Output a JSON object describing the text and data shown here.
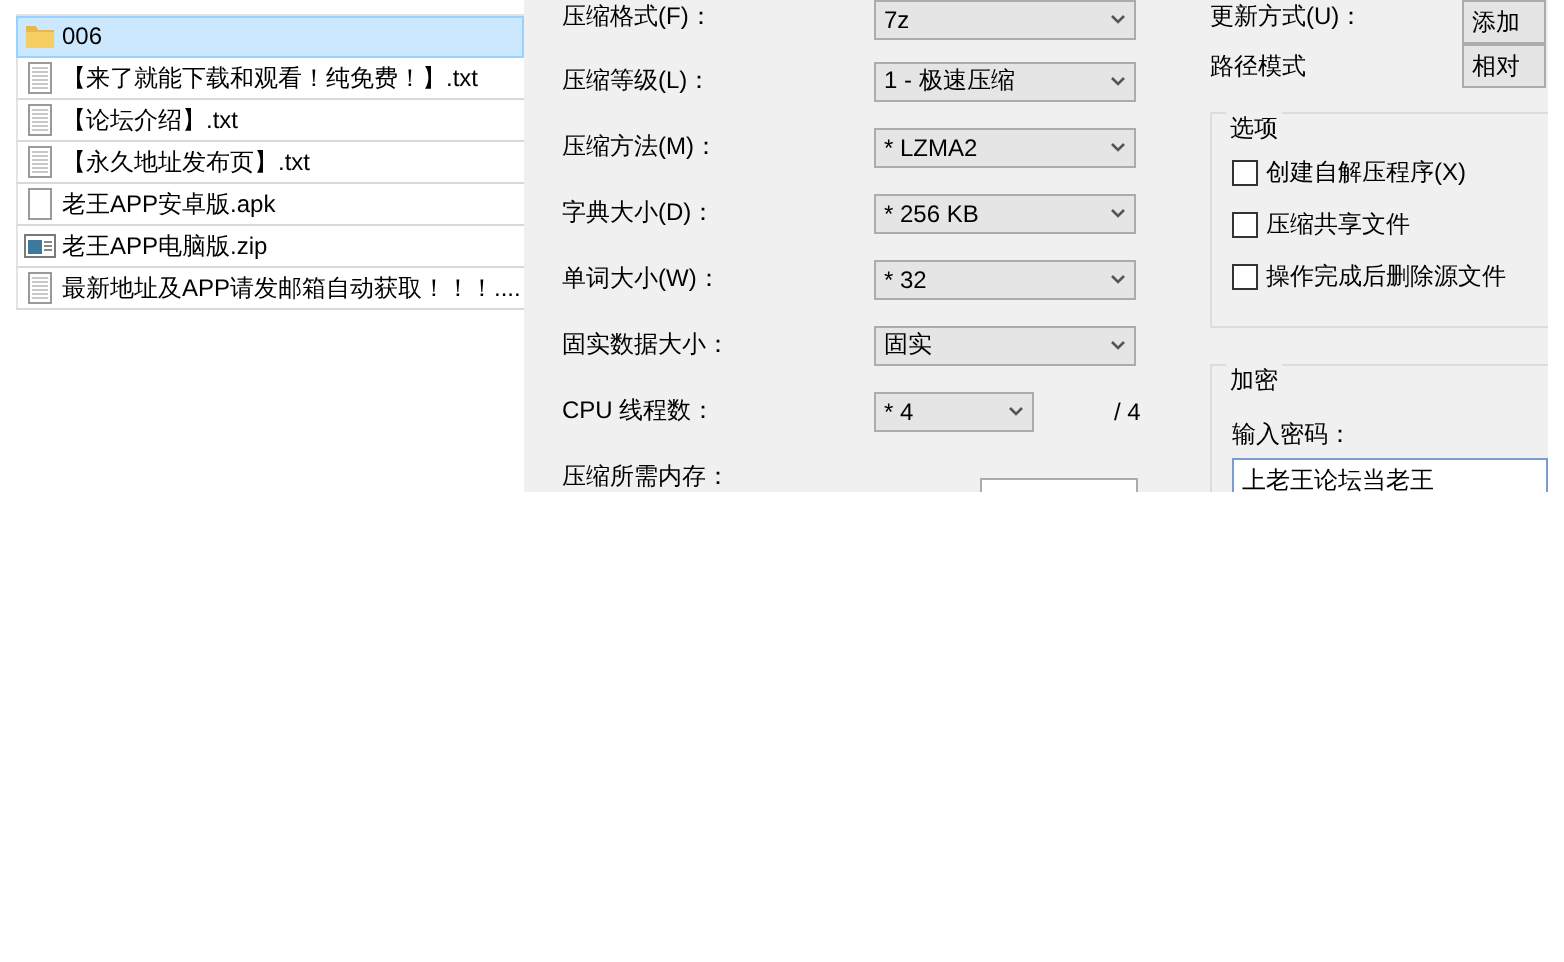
{
  "files": [
    {
      "name": "006",
      "kind": "folder",
      "selected": true
    },
    {
      "name": "【来了就能下载和观看！纯免费！】.txt",
      "kind": "text",
      "selected": false
    },
    {
      "name": "【论坛介绍】.txt",
      "kind": "text",
      "selected": false
    },
    {
      "name": "【永久地址发布页】.txt",
      "kind": "text",
      "selected": false
    },
    {
      "name": "老王APP安卓版.apk",
      "kind": "file",
      "selected": false
    },
    {
      "name": "老王APP电脑版.zip",
      "kind": "archive",
      "selected": false
    },
    {
      "name": "最新地址及APP请发邮箱自动获取！！！....",
      "kind": "text",
      "selected": false
    }
  ],
  "compression": {
    "fields": [
      {
        "label": "压缩格式(F)：",
        "value": "7z",
        "kind": "select"
      },
      {
        "label": "压缩等级(L)：",
        "value": "1 - 极速压缩",
        "kind": "select"
      },
      {
        "label": "压缩方法(M)：",
        "value": "* LZMA2",
        "kind": "select"
      },
      {
        "label": "字典大小(D)：",
        "value": "* 256 KB",
        "kind": "select"
      },
      {
        "label": "单词大小(W)：",
        "value": "* 32",
        "kind": "select"
      },
      {
        "label": "固实数据大小：",
        "value": "固实",
        "kind": "select"
      },
      {
        "label": "CPU 线程数：",
        "value": "* 4",
        "kind": "small-select",
        "suffix": "/ 4"
      },
      {
        "label": "压缩所需内存：",
        "kind": "memory"
      }
    ]
  },
  "update_mode": {
    "label": "更新方式(U)：",
    "value": "添加"
  },
  "path_mode": {
    "label": "路径模式",
    "value": "相对"
  },
  "options": {
    "title": "选项",
    "items": [
      {
        "label": "创建自解压程序(X)",
        "checked": false
      },
      {
        "label": "压缩共享文件",
        "checked": false
      },
      {
        "label": "操作完成后删除源文件",
        "checked": false
      }
    ]
  },
  "encryption": {
    "title": "加密",
    "label": "输入密码：",
    "value": "上老王论坛当老王"
  }
}
